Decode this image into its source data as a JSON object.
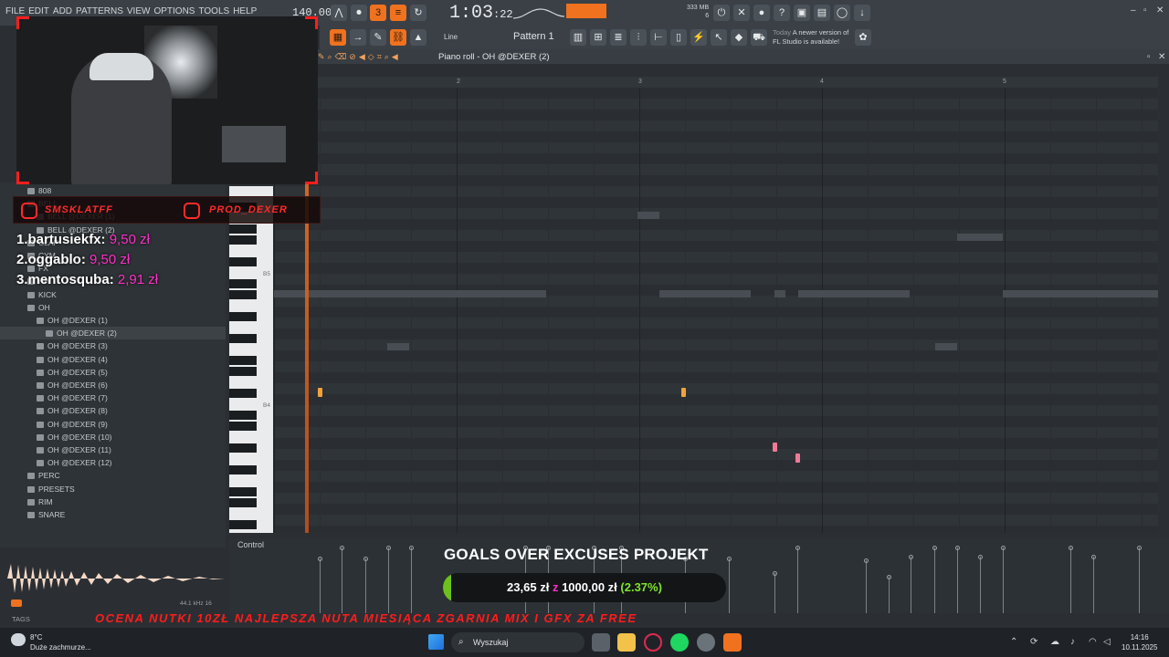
{
  "menu": [
    "FILE",
    "EDIT",
    "ADD",
    "PATTERNS",
    "VIEW",
    "OPTIONS",
    "TOOLS",
    "HELP"
  ],
  "transport": {
    "tempo": "140.000",
    "time_main": "1:03",
    "time_sub": ":22",
    "mem_top": "333 MB",
    "mem_bottom": "6"
  },
  "toolbar2": {
    "snap": "Line",
    "pattern": "Pattern 1",
    "update_prefix": "Today",
    "update_line1": "A newer version of",
    "update_line2": "FL Studio is available!"
  },
  "piano_roll": {
    "title": "Piano roll - OH @DEXER (2)",
    "ruler": [
      "2",
      "3",
      "4",
      "5"
    ],
    "key_labels": [
      "B5",
      "B4"
    ],
    "control_label": "Control"
  },
  "browser": {
    "items": [
      {
        "label": "808",
        "indent": 1,
        "selected": false
      },
      {
        "label": "BELL",
        "indent": 1,
        "selected": false
      },
      {
        "label": "BELL @DEXER (1)",
        "indent": 2,
        "selected": false
      },
      {
        "label": "BELL @DEXER (2)",
        "indent": 2,
        "selected": false
      },
      {
        "label": "CLAP",
        "indent": 1,
        "selected": false
      },
      {
        "label": "CYM",
        "indent": 1,
        "selected": false
      },
      {
        "label": "FX",
        "indent": 1,
        "selected": false
      },
      {
        "label": "HH",
        "indent": 1,
        "selected": false
      },
      {
        "label": "KICK",
        "indent": 1,
        "selected": false
      },
      {
        "label": "OH",
        "indent": 1,
        "selected": false
      },
      {
        "label": "OH @DEXER (1)",
        "indent": 2,
        "selected": false
      },
      {
        "label": "OH @DEXER (2)",
        "indent": 3,
        "selected": true
      },
      {
        "label": "OH @DEXER (3)",
        "indent": 2,
        "selected": false
      },
      {
        "label": "OH @DEXER (4)",
        "indent": 2,
        "selected": false
      },
      {
        "label": "OH @DEXER (5)",
        "indent": 2,
        "selected": false
      },
      {
        "label": "OH @DEXER (6)",
        "indent": 2,
        "selected": false
      },
      {
        "label": "OH @DEXER (7)",
        "indent": 2,
        "selected": false
      },
      {
        "label": "OH @DEXER (8)",
        "indent": 2,
        "selected": false
      },
      {
        "label": "OH @DEXER (9)",
        "indent": 2,
        "selected": false
      },
      {
        "label": "OH @DEXER (10)",
        "indent": 2,
        "selected": false
      },
      {
        "label": "OH @DEXER (11)",
        "indent": 2,
        "selected": false
      },
      {
        "label": "OH @DEXER (12)",
        "indent": 2,
        "selected": false
      },
      {
        "label": "PERC",
        "indent": 1,
        "selected": false
      },
      {
        "label": "PRESETS",
        "indent": 1,
        "selected": false
      },
      {
        "label": "RIM",
        "indent": 1,
        "selected": false
      },
      {
        "label": "SNARE",
        "indent": 1,
        "selected": false
      }
    ],
    "samplerate": "44.1 kHz 16",
    "tags": "TAGS"
  },
  "overlay": {
    "ig_handles": [
      "SMSKLATFF",
      "PROD_DEXER"
    ],
    "donors": [
      {
        "rank": "1.",
        "name": "bartusiekfx:",
        "amount": "9,50 zł"
      },
      {
        "rank": "2.",
        "name": "oggablo:",
        "amount": "9,50 zł"
      },
      {
        "rank": "3.",
        "name": "mentosquba:",
        "amount": "2,91 zł"
      }
    ],
    "goal_title": "GOALS OVER EXCUSES PROJEKT",
    "goal_current": "23,65 zł",
    "goal_sep": "z",
    "goal_target": "1000,00 zł",
    "goal_pct_label": "(2.37%)",
    "goal_progress": 0.0237,
    "ticker": "OCENA NUTKI 10ZŁ  NAJLEPSZA NUTA MIESIĄCA ZGARNIA MIX I GFX ZA FREE"
  },
  "taskbar": {
    "temp": "8°C",
    "weather": "Duże zachmurze...",
    "search": "Wyszukaj",
    "time": "14:16",
    "date": "10.11.2025"
  },
  "colors": {
    "accent": "#f0721f",
    "overlay_red": "#ff1d1d",
    "magenta": "#ff2fc8",
    "goal_green": "#6cc21a"
  }
}
